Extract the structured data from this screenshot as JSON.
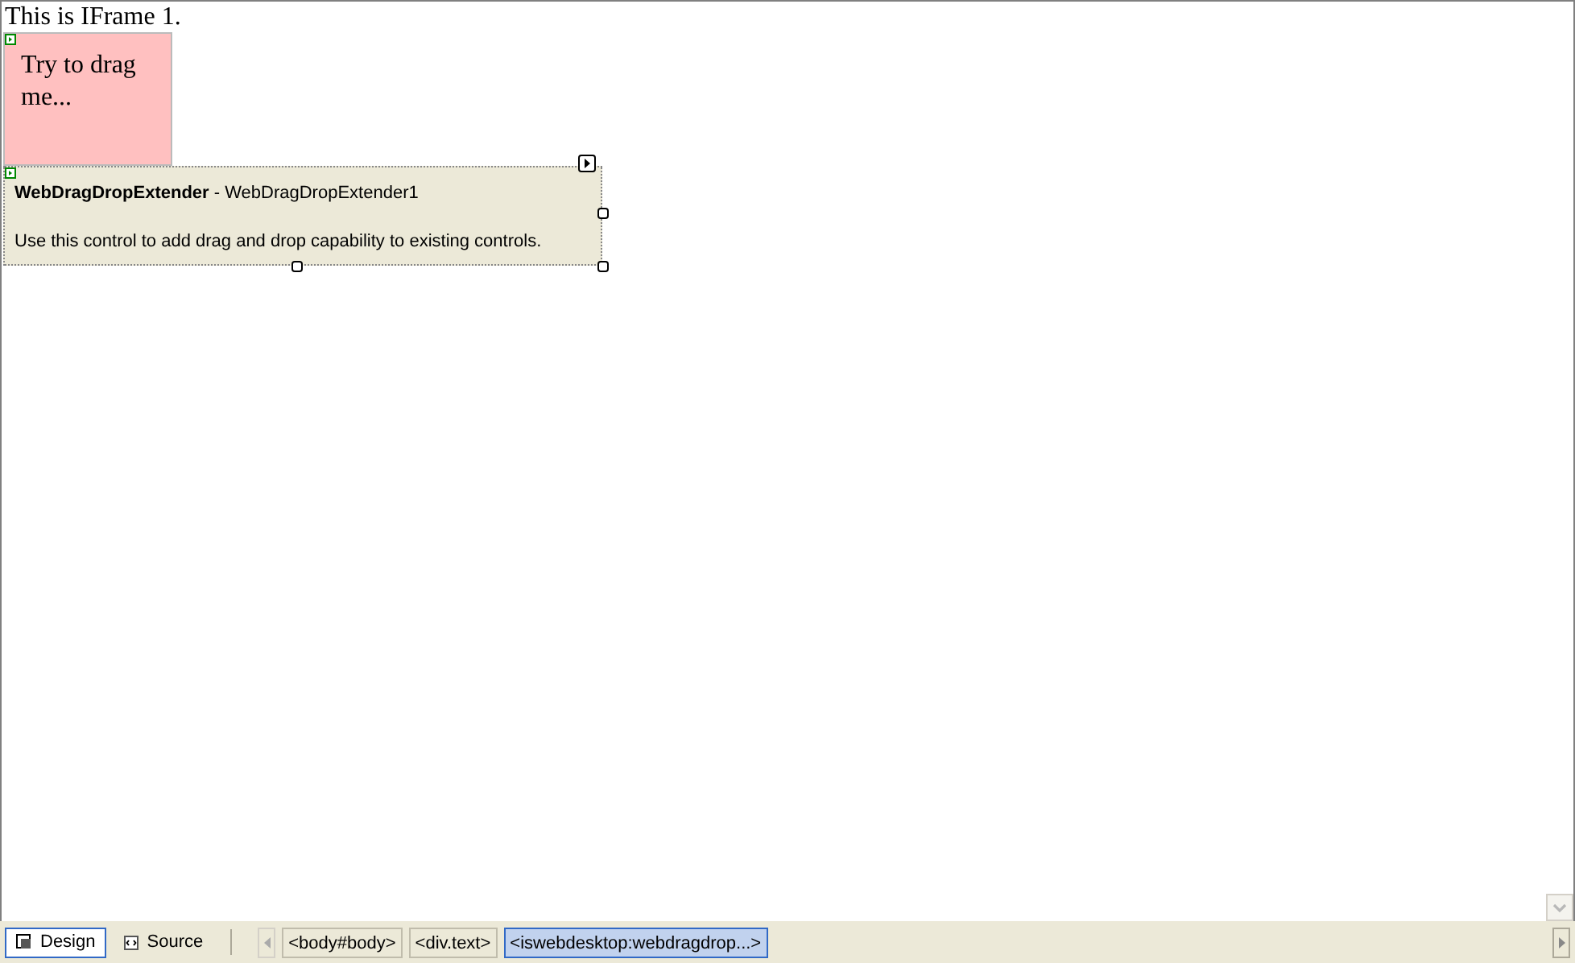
{
  "canvas": {
    "heading": "This is IFrame 1.",
    "drag_box": {
      "text": "Try to drag me..."
    },
    "extender": {
      "title": "**WebDragDropExtender** - WebDragDropExtender1",
      "description": "Use this control to add drag and drop capability to existing controls."
    }
  },
  "view_tabs": [
    {
      "label": "Design",
      "selected": true
    },
    {
      "label": "Source",
      "selected": false
    }
  ],
  "breadcrumbs": [
    {
      "label": "<body#body>",
      "selected": false
    },
    {
      "label": "<div.text>",
      "selected": false
    },
    {
      "label": "<iswebdesktop:webdragdrop...>",
      "selected": true
    }
  ]
}
